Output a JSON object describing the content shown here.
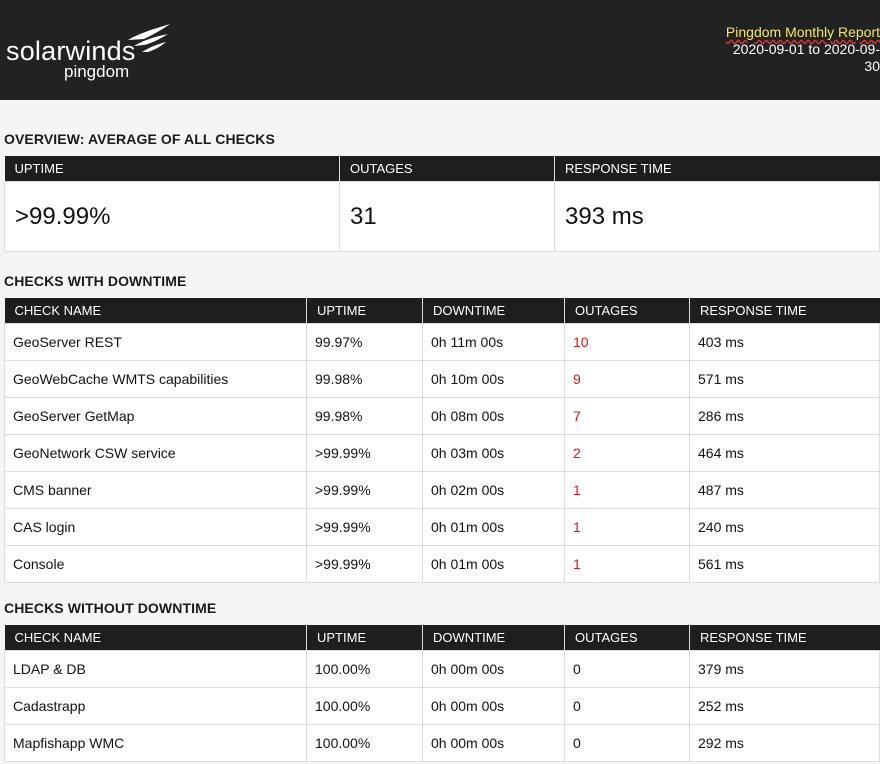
{
  "header": {
    "logo_text": "solarwinds",
    "logo_sub": "pingdom",
    "report_title": "Pingdom Monthly Report",
    "date_range": "2020-09-01 to 2020-09-",
    "date_range_cont": "30"
  },
  "overview": {
    "title": "OVERVIEW: AVERAGE OF ALL CHECKS",
    "headers": [
      "UPTIME",
      "OUTAGES",
      "RESPONSE TIME"
    ],
    "values": [
      ">99.99%",
      "31",
      "393 ms"
    ]
  },
  "with_downtime": {
    "title": "CHECKS WITH DOWNTIME",
    "headers": [
      "CHECK NAME",
      "UPTIME",
      "DOWNTIME",
      "OUTAGES",
      "RESPONSE TIME"
    ],
    "rows": [
      [
        "GeoServer REST",
        "99.97%",
        "0h 11m 00s",
        "10",
        "403 ms"
      ],
      [
        "GeoWebCache WMTS capabilities",
        "99.98%",
        "0h 10m 00s",
        "9",
        "571 ms"
      ],
      [
        "GeoServer GetMap",
        "99.98%",
        "0h 08m 00s",
        "7",
        "286 ms"
      ],
      [
        "GeoNetwork CSW service",
        ">99.99%",
        "0h 03m 00s",
        "2",
        "464 ms"
      ],
      [
        "CMS banner",
        ">99.99%",
        "0h 02m 00s",
        "1",
        "487 ms"
      ],
      [
        "CAS login",
        ">99.99%",
        "0h 01m 00s",
        "1",
        "240 ms"
      ],
      [
        "Console",
        ">99.99%",
        "0h 01m 00s",
        "1",
        "561 ms"
      ]
    ]
  },
  "without_downtime": {
    "title": "CHECKS WITHOUT DOWNTIME",
    "headers": [
      "CHECK NAME",
      "UPTIME",
      "DOWNTIME",
      "OUTAGES",
      "RESPONSE TIME"
    ],
    "rows": [
      [
        "LDAP & DB",
        "100.00%",
        "0h 00m 00s",
        "0",
        "379 ms"
      ],
      [
        "Cadastrapp",
        "100.00%",
        "0h 00m 00s",
        "0",
        "252 ms"
      ],
      [
        "Mapfishapp WMC",
        "100.00%",
        "0h 00m 00s",
        "0",
        "292 ms"
      ]
    ]
  },
  "colors": {
    "header_bg": "#222222",
    "outage_red": "#e0141b",
    "title_yellow": "#f5e663"
  }
}
